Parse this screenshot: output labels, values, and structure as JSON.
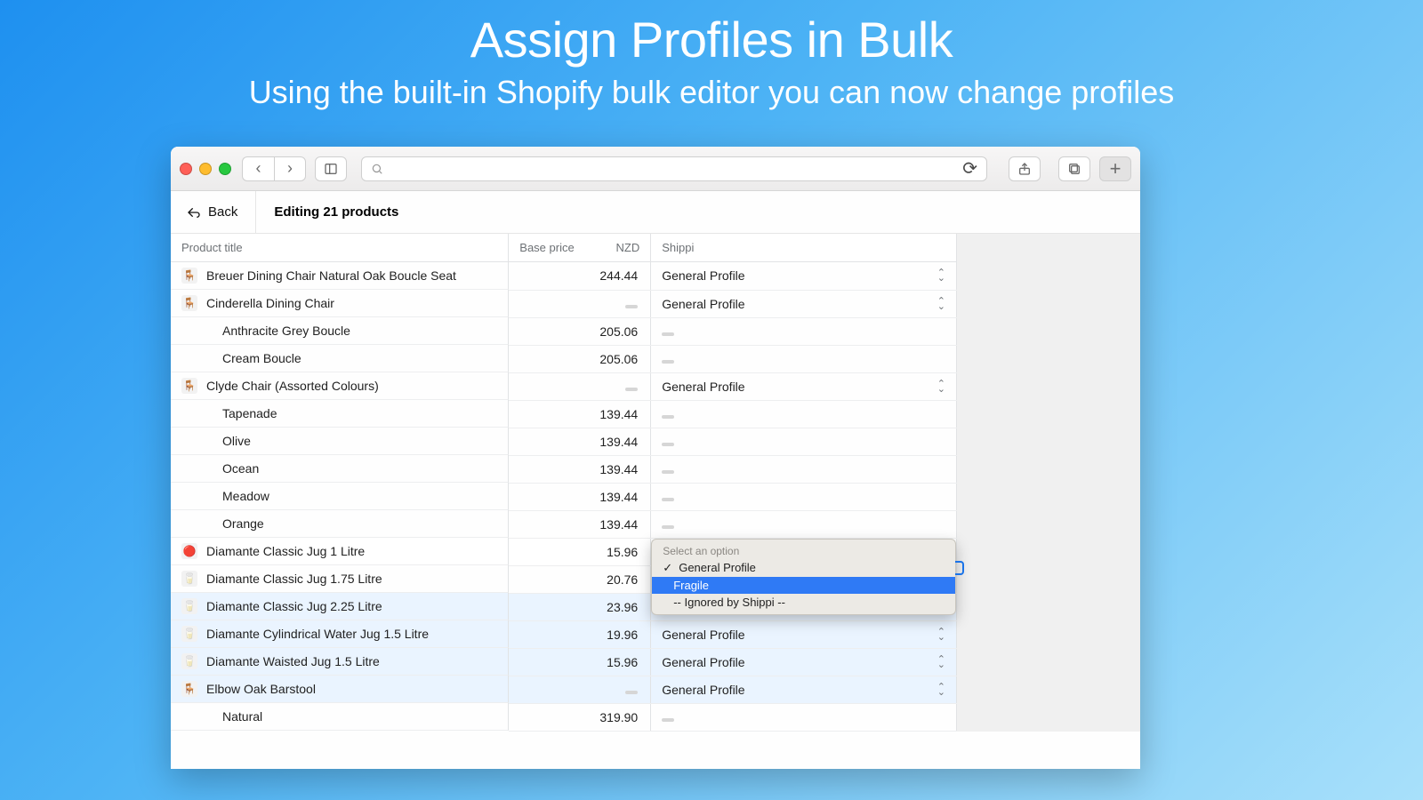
{
  "hero": {
    "title": "Assign Profiles in Bulk",
    "subtitle": "Using the built-in Shopify bulk editor you can now change profiles"
  },
  "topbar": {
    "back_label": "Back",
    "editing_label": "Editing 21 products"
  },
  "columns": {
    "title": "Product title",
    "base_price": "Base price",
    "currency": "NZD",
    "shippi": "Shippi"
  },
  "profiles": {
    "general": "General Profile"
  },
  "dropdown": {
    "header": "Select an option",
    "options": [
      "General Profile",
      "Fragile",
      "-- Ignored by Shippi --"
    ],
    "checked": 0,
    "highlighted": 1
  },
  "rows": [
    {
      "type": "product",
      "title": "Breuer Dining Chair Natural Oak Boucle Seat",
      "price": "244.44",
      "profile": "general",
      "thumb": "🪑"
    },
    {
      "type": "product",
      "title": "Cinderella Dining Chair",
      "price": null,
      "profile": "general",
      "thumb": "🪑"
    },
    {
      "type": "variant",
      "title": "Anthracite Grey Boucle",
      "price": "205.06",
      "profile": null
    },
    {
      "type": "variant",
      "title": "Cream Boucle",
      "price": "205.06",
      "profile": null
    },
    {
      "type": "product",
      "title": "Clyde Chair (Assorted Colours)",
      "price": null,
      "profile": "general",
      "thumb": "🪑"
    },
    {
      "type": "variant",
      "title": "Tapenade",
      "price": "139.44",
      "profile": null
    },
    {
      "type": "variant",
      "title": "Olive",
      "price": "139.44",
      "profile": null
    },
    {
      "type": "variant",
      "title": "Ocean",
      "price": "139.44",
      "profile": null
    },
    {
      "type": "variant",
      "title": "Meadow",
      "price": "139.44",
      "profile": null
    },
    {
      "type": "variant",
      "title": "Orange",
      "price": "139.44",
      "profile": null
    },
    {
      "type": "product",
      "title": "Diamante Classic Jug 1 Litre",
      "price": "15.96",
      "profile": "dropdown",
      "thumb": "🔴"
    },
    {
      "type": "product",
      "title": "Diamante Classic Jug 1.75 Litre",
      "price": "20.76",
      "profile": "dropdown-covered",
      "thumb": "🥛"
    },
    {
      "type": "product",
      "title": "Diamante Classic Jug 2.25 Litre",
      "price": "23.96",
      "profile": "general",
      "thumb": "🥛",
      "hl": true
    },
    {
      "type": "product",
      "title": "Diamante Cylindrical Water Jug 1.5 Litre",
      "price": "19.96",
      "profile": "general",
      "thumb": "🥛",
      "hl": true
    },
    {
      "type": "product",
      "title": "Diamante Waisted Jug 1.5 Litre",
      "price": "15.96",
      "profile": "general",
      "thumb": "🥛",
      "hl": true
    },
    {
      "type": "product",
      "title": "Elbow Oak Barstool",
      "price": null,
      "profile": "general",
      "thumb": "🪑",
      "hl": true
    },
    {
      "type": "variant",
      "title": "Natural",
      "price": "319.90",
      "profile": null
    }
  ]
}
